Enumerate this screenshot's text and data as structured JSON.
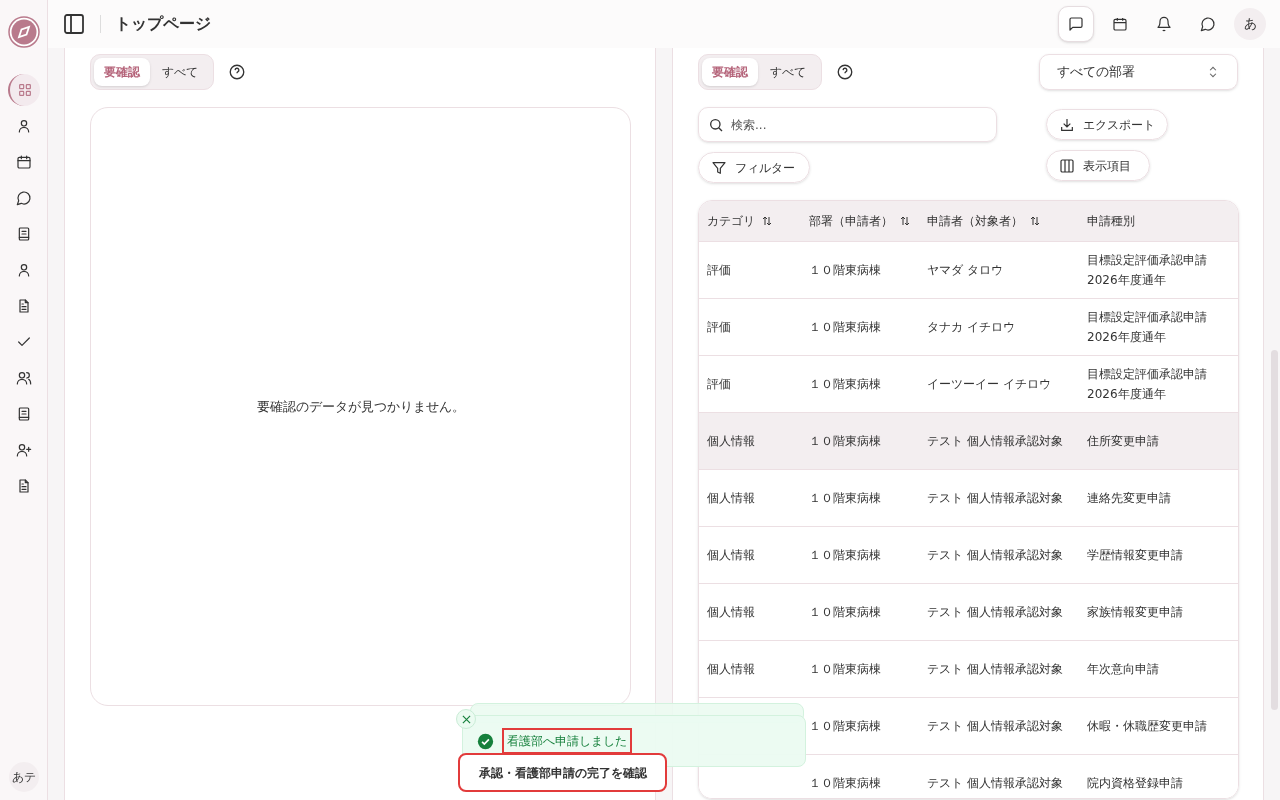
{
  "header": {
    "title": "トップページ",
    "avatar": "あ"
  },
  "sidebar": {
    "items": [
      {
        "selected": true
      },
      {
        "selected": false
      },
      {
        "selected": false
      },
      {
        "selected": false
      },
      {
        "selected": false
      },
      {
        "selected": false
      },
      {
        "selected": false
      },
      {
        "selected": false
      },
      {
        "selected": false
      },
      {
        "selected": false
      },
      {
        "selected": false
      },
      {
        "selected": false
      }
    ],
    "avatar": "あテ"
  },
  "left_panel": {
    "tabs": [
      {
        "label": "要確認",
        "selected": true
      },
      {
        "label": "すべて",
        "selected": false
      }
    ],
    "empty_message": "要確認のデータが見つかりません。"
  },
  "right_panel": {
    "tabs": [
      {
        "label": "要確認",
        "selected": true
      },
      {
        "label": "すべて",
        "selected": false
      }
    ],
    "department_select": "すべての部署",
    "search": {
      "placeholder": "検索..."
    },
    "buttons": {
      "filter": "フィルター",
      "export": "エクスポート",
      "columns": "表示項目"
    },
    "table": {
      "columns": [
        {
          "label": "カテゴリ",
          "sortable": true
        },
        {
          "label": "部署（申請者）",
          "sortable": true
        },
        {
          "label": "申請者（対象者）",
          "sortable": true
        },
        {
          "label": "申請種別",
          "sortable": false
        }
      ],
      "rows": [
        {
          "cells": [
            "評価",
            "１０階東病棟",
            "ヤマダ タロウ",
            "目標設定評価承認申請 2026年度通年"
          ],
          "highlighted": false
        },
        {
          "cells": [
            "評価",
            "１０階東病棟",
            "タナカ イチロウ",
            "目標設定評価承認申請 2026年度通年"
          ],
          "highlighted": false
        },
        {
          "cells": [
            "評価",
            "１０階東病棟",
            "イーツーイー イチロウ",
            "目標設定評価承認申請 2026年度通年"
          ],
          "highlighted": false
        },
        {
          "cells": [
            "個人情報",
            "１０階東病棟",
            "テスト 個人情報承認対象",
            "住所変更申請"
          ],
          "highlighted": true
        },
        {
          "cells": [
            "個人情報",
            "１０階東病棟",
            "テスト 個人情報承認対象",
            "連絡先変更申請"
          ],
          "highlighted": false
        },
        {
          "cells": [
            "個人情報",
            "１０階東病棟",
            "テスト 個人情報承認対象",
            "学歴情報変更申請"
          ],
          "highlighted": false
        },
        {
          "cells": [
            "個人情報",
            "１０階東病棟",
            "テスト 個人情報承認対象",
            "家族情報変更申請"
          ],
          "highlighted": false
        },
        {
          "cells": [
            "個人情報",
            "１０階東病棟",
            "テスト 個人情報承認対象",
            "年次意向申請"
          ],
          "highlighted": false
        },
        {
          "cells": [
            "１０階東病棟",
            "テスト 個人情報承認対象",
            "休暇・休職歴変更申請"
          ],
          "highlighted": false
        },
        {
          "cells": [
            "１０階東病棟",
            "テスト 個人情報承認対象",
            "院内資格登録申請"
          ],
          "highlighted": false
        }
      ]
    }
  },
  "toast": {
    "message": "看護部へ申請しました"
  },
  "callout": {
    "text": "承認・看護部申請の完了を確認"
  }
}
